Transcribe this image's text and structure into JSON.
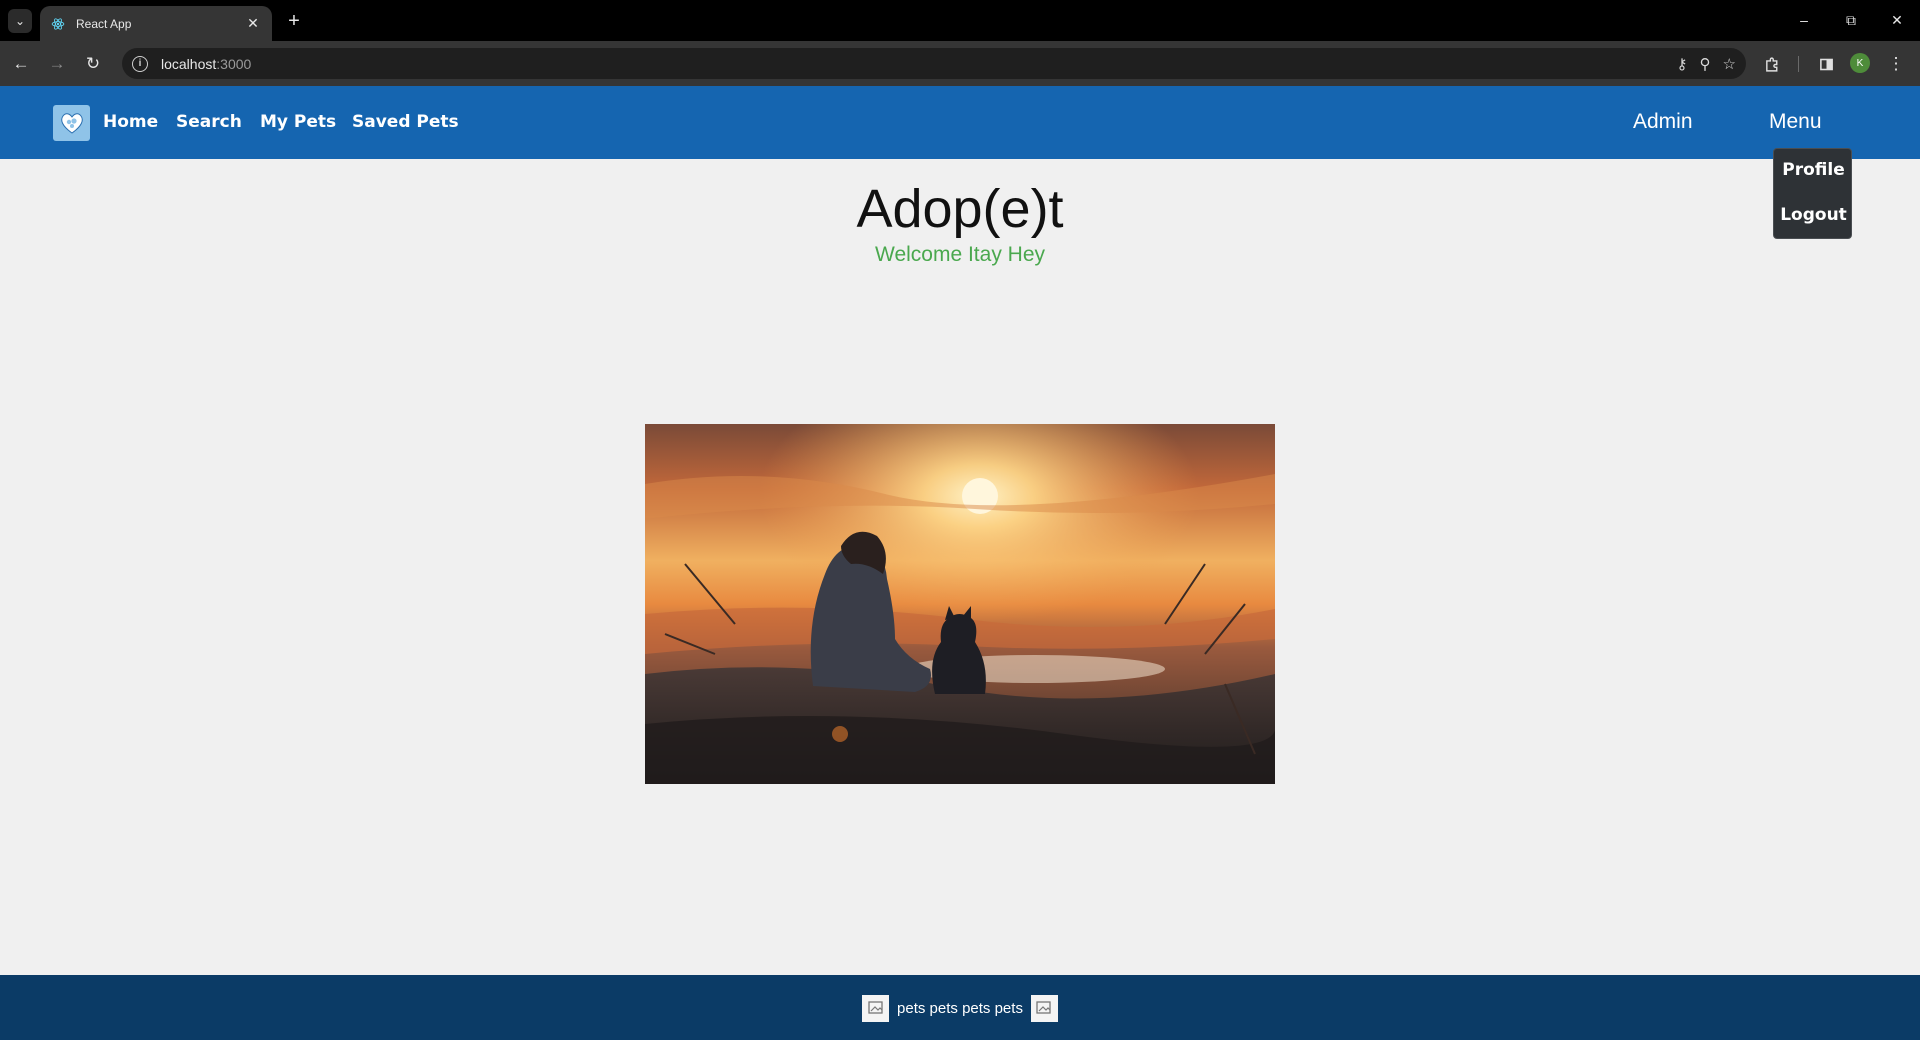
{
  "browser": {
    "tab_title": "React App",
    "url_host": "localhost",
    "url_port": ":3000",
    "profile_initial": "K"
  },
  "navbar": {
    "links": [
      "Home",
      "Search",
      "My Pets",
      "Saved Pets"
    ],
    "admin_label": "Admin",
    "menu_label": "Menu"
  },
  "dropdown": {
    "items": [
      "Profile",
      "Logout"
    ]
  },
  "main": {
    "title": "Adop(e)t",
    "welcome": "Welcome Itay Hey"
  },
  "footer": {
    "text": "pets pets pets pets"
  },
  "colors": {
    "navbar": "#1565b0",
    "footer": "#0b3b66",
    "welcome": "#4aa84e",
    "background": "#f0f0f0"
  }
}
